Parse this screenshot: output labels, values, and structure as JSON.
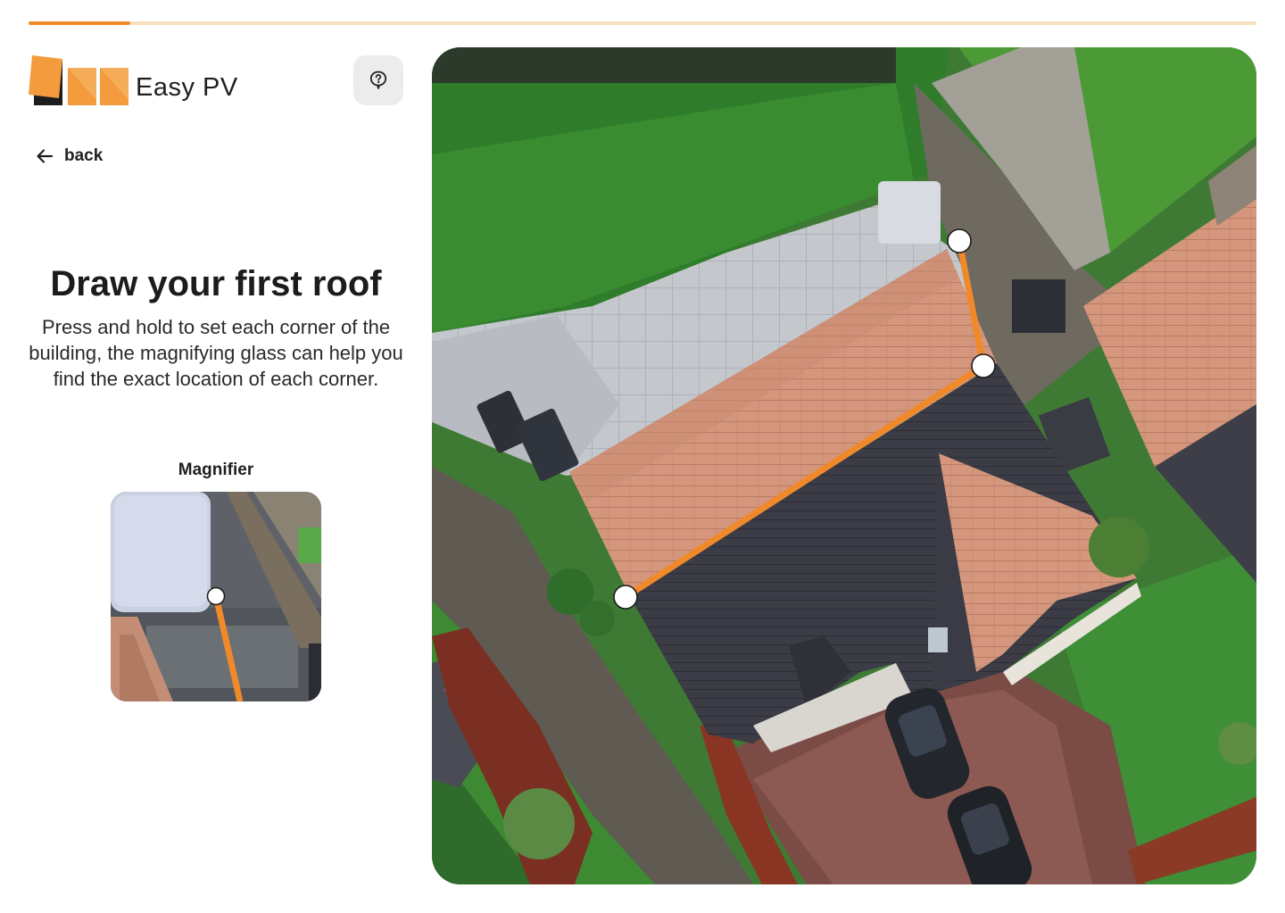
{
  "progress": {
    "fraction": 0.083,
    "track_color": "#f8dfbd",
    "fill_color": "#f0892a"
  },
  "brand": {
    "name": "Easy PV",
    "accent": "#f39b3d",
    "accent_dark": "#e8861f"
  },
  "help": {
    "icon": "help-bubble-icon"
  },
  "navigation": {
    "back_label": "back",
    "back_icon": "arrow-left-icon"
  },
  "instructions": {
    "title": "Draw your first roof",
    "body": "Press and hold to set each corner of the building, the magnifying glass can help you find the exact location of each corner."
  },
  "magnifier": {
    "label": "Magnifier"
  },
  "roof_drawing": {
    "corners_placed": 3,
    "line_color": "#f0892a",
    "marker_color": "#ffffff"
  }
}
